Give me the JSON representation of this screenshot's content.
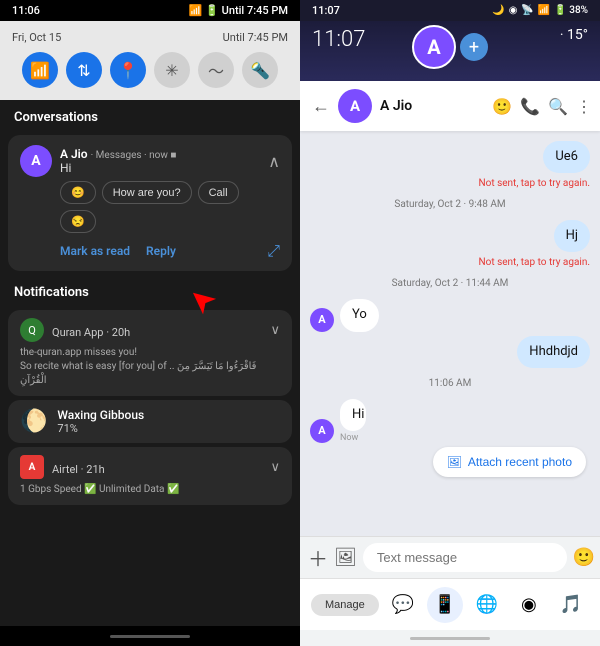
{
  "left": {
    "statusBar": {
      "time": "11:06",
      "signal": "📶",
      "wifi": "WiFi",
      "battery": "Until 7:45 PM"
    },
    "date": "Fri, Oct 15",
    "until": "Until 7:45 PM",
    "quickSettings": {
      "icons": [
        {
          "name": "wifi",
          "symbol": "📶",
          "active": true
        },
        {
          "name": "data",
          "symbol": "⇅",
          "active": true
        },
        {
          "name": "location",
          "symbol": "📍",
          "active": true
        },
        {
          "name": "bluetooth",
          "symbol": "🔷",
          "active": false
        },
        {
          "name": "sync",
          "symbol": "≈",
          "active": false
        },
        {
          "name": "flashlight",
          "symbol": "🔦",
          "active": false
        }
      ]
    },
    "conversations": {
      "title": "Conversations",
      "card": {
        "name": "A Jio",
        "source": "Messages",
        "time": "now",
        "message": "Hi",
        "quickReplies": [
          "😊",
          "How are you?",
          "Call",
          "😒"
        ],
        "actions": [
          "Mark as read",
          "Reply"
        ]
      }
    },
    "notifications": {
      "title": "Notifications",
      "items": [
        {
          "app": "Quran App",
          "time": "20h",
          "body": "the-quran.app misses you!\nSo recite what is easy [for you] of .. فَاقْرَءُوا مَا تَيَسَّرَ مِنَ الْقُرْآنِ"
        },
        {
          "title": "Waxing Gibbous",
          "subtitle": "71%",
          "icon": "🌔"
        },
        {
          "app": "Airtel",
          "time": "21h",
          "body": "1 Gbps Speed ✅ Unlimited Data ✅"
        }
      ]
    }
  },
  "right": {
    "statusBar": {
      "time": "11:07",
      "icons": "🌙 ◉ 📡 🔋 38%"
    },
    "floatingTime": "11:07",
    "floatingTemp": "15°",
    "chat": {
      "contactName": "A Jio",
      "messages": [
        {
          "type": "out",
          "text": "Ue6",
          "error": "Not sent, tap to try again."
        },
        {
          "type": "timestamp",
          "text": "Saturday, Oct 2 · 9:48 AM"
        },
        {
          "type": "out",
          "text": "Hj",
          "error": "Not sent, tap to try again."
        },
        {
          "type": "timestamp",
          "text": "Saturday, Oct 2 · 11:44 AM"
        },
        {
          "type": "in",
          "text": "Yo"
        },
        {
          "type": "out",
          "text": "Hhdhdjd"
        },
        {
          "type": "timestamp",
          "text": "11:06 AM"
        },
        {
          "type": "in",
          "text": "Hi",
          "time": "Now"
        },
        {
          "type": "attach",
          "text": "Attach recent photo"
        }
      ],
      "inputPlaceholder": "Text message",
      "attachPhotoLabel": "Attach recent photo"
    },
    "bottomNav": {
      "manageLabel": "Manage",
      "icons": [
        "☎",
        "💬",
        "🌐",
        "🎵"
      ]
    }
  }
}
